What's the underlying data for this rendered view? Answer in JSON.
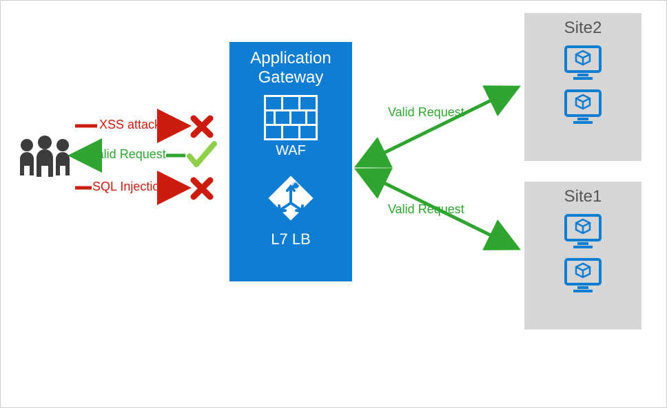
{
  "gateway": {
    "title_line1": "Application",
    "title_line2": "Gateway",
    "waf_label": "WAF",
    "lb_label": "L7 LB"
  },
  "requests": {
    "xss": "XSS attack",
    "valid": "Valid Request",
    "sql": "SQL Injection"
  },
  "routes": {
    "to_site2": "Valid Request",
    "to_site1": "Valid Request"
  },
  "sites": {
    "site2": {
      "label": "Site2"
    },
    "site1": {
      "label": "Site1"
    }
  },
  "colors": {
    "red": "#cc1c0d",
    "green": "#2fa52f",
    "blue": "#0e7dd2",
    "grey": "#d6d6d6",
    "dark": "#3c3c3c"
  }
}
